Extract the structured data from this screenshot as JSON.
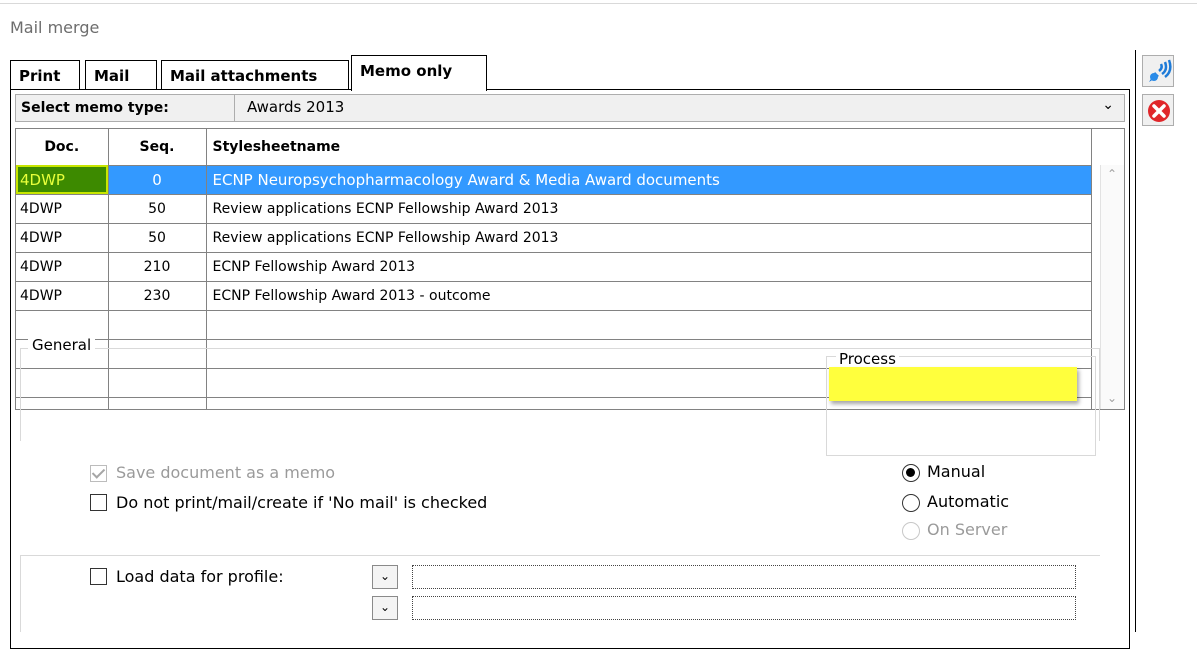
{
  "window": {
    "title": "Mail merge"
  },
  "tabs": [
    {
      "label": "Print",
      "active": false
    },
    {
      "label": "Mail",
      "active": false
    },
    {
      "label": "Mail attachments",
      "active": false
    },
    {
      "label": "Memo only",
      "active": true
    }
  ],
  "memo": {
    "label": "Select memo type:",
    "value": "Awards 2013"
  },
  "grid": {
    "columns": [
      "Doc.",
      "Seq.",
      "Stylesheetname"
    ],
    "rows": [
      {
        "doc": "4DWP",
        "seq": "0",
        "name": "ECNP Neuropsychopharmacology Award & Media Award documents",
        "selected": true
      },
      {
        "doc": "4DWP",
        "seq": "50",
        "name": "Review applications ECNP Fellowship Award 2013",
        "selected": false
      },
      {
        "doc": "4DWP",
        "seq": "50",
        "name": "Review applications ECNP Fellowship Award 2013",
        "selected": false
      },
      {
        "doc": "4DWP",
        "seq": "210",
        "name": "ECNP Fellowship Award 2013",
        "selected": false
      },
      {
        "doc": "4DWP",
        "seq": "230",
        "name": "ECNP Fellowship Award 2013 - outcome",
        "selected": false
      }
    ]
  },
  "general": {
    "legend": "General",
    "save_memo": {
      "label": "Save document as a memo",
      "checked": true,
      "disabled": true
    },
    "no_print": {
      "label": "Do not print/mail/create if 'No mail' is checked",
      "checked": false
    },
    "load_profile": {
      "label": "Load data for profile:",
      "checked": false
    }
  },
  "process": {
    "legend": "Process",
    "options": [
      {
        "label": "Manual",
        "checked": true,
        "disabled": false
      },
      {
        "label": "Automatic",
        "checked": false,
        "disabled": false
      },
      {
        "label": "On Server",
        "checked": false,
        "disabled": true
      }
    ]
  },
  "toolbar": {
    "icons": [
      "run-merge-icon",
      "cancel-icon"
    ]
  },
  "colors": {
    "selection": "#3399ff",
    "highlight": "#ffff3d",
    "doc_cell": "#3d8a00"
  }
}
